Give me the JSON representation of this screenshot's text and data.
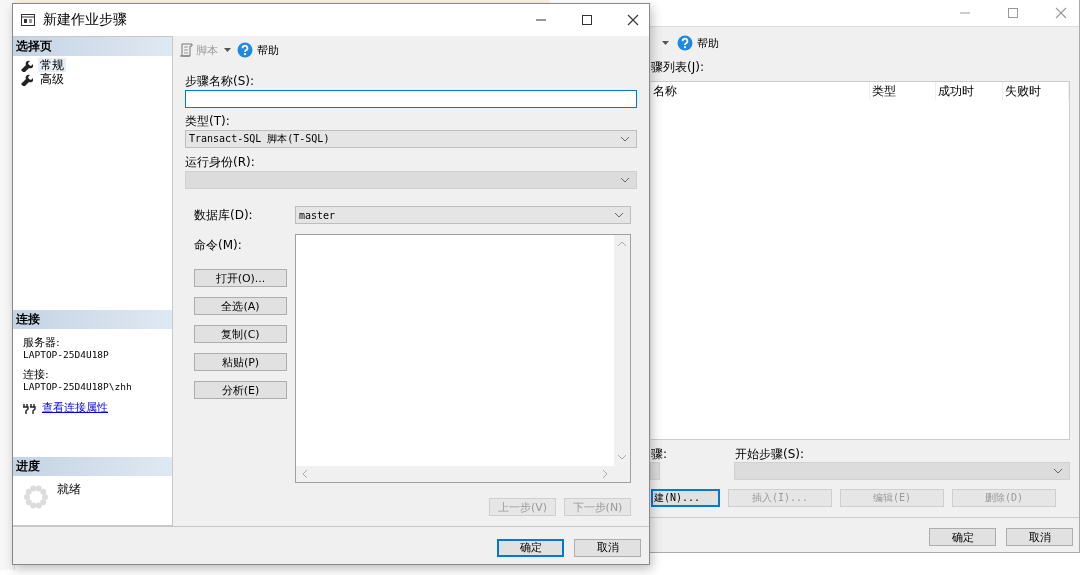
{
  "background_window": {
    "toolbar": {
      "help": "帮助"
    },
    "steps_list_label": "骤列表(J):",
    "table": {
      "columns": [
        "名称",
        "类型",
        "成功时",
        "失败时"
      ]
    },
    "on_success_label": "骤:",
    "start_step": {
      "label": "开始步骤(S):",
      "disabled": true
    },
    "buttons": [
      {
        "label": "建(N)...",
        "disabled": false,
        "focused": true
      },
      {
        "label": "插入(I)...",
        "disabled": true,
        "focused": false
      },
      {
        "label": "编辑(E)",
        "disabled": true,
        "focused": false
      },
      {
        "label": "删除(D)",
        "disabled": true,
        "focused": false
      }
    ],
    "dialog_buttons": [
      {
        "label": "确定"
      },
      {
        "label": "取消"
      }
    ]
  },
  "dialog": {
    "title": "新建作业步骤",
    "sidebar": {
      "select_page": {
        "header": "选择页",
        "items": [
          {
            "label": "常规",
            "selected": true
          },
          {
            "label": "高级",
            "selected": false
          }
        ]
      },
      "connection": {
        "header": "连接",
        "server_label": "服务器:",
        "server": "LAPTOP-25D4U18P",
        "connection_label": "连接:",
        "connection": "LAPTOP-25D4U18P\\zhh",
        "link": "查看连接属性"
      },
      "progress": {
        "header": "进度",
        "status": "就绪"
      }
    },
    "toolbar": {
      "script": {
        "label": "脚本",
        "disabled": true
      },
      "help": "帮助"
    },
    "step_name": {
      "label": "步骤名称(S):"
    },
    "type": {
      "label": "类型(T):",
      "value": "Transact-SQL 脚本(T-SQL)"
    },
    "run_as": {
      "label": "运行身份(R):",
      "disabled": true
    },
    "database": {
      "label": "数据库(D):",
      "value": "master"
    },
    "command": {
      "label": "命令(M):"
    },
    "command_buttons": [
      "打开(O)...",
      "全选(A)",
      "复制(C)",
      "粘贴(P)",
      "分析(E)"
    ],
    "nav_buttons": [
      {
        "label": "上一步(V)",
        "disabled": true
      },
      {
        "label": "下一步(N)",
        "disabled": true
      }
    ],
    "dialog_buttons": [
      {
        "label": "确定",
        "default": true
      },
      {
        "label": "取消",
        "default": false
      }
    ]
  }
}
